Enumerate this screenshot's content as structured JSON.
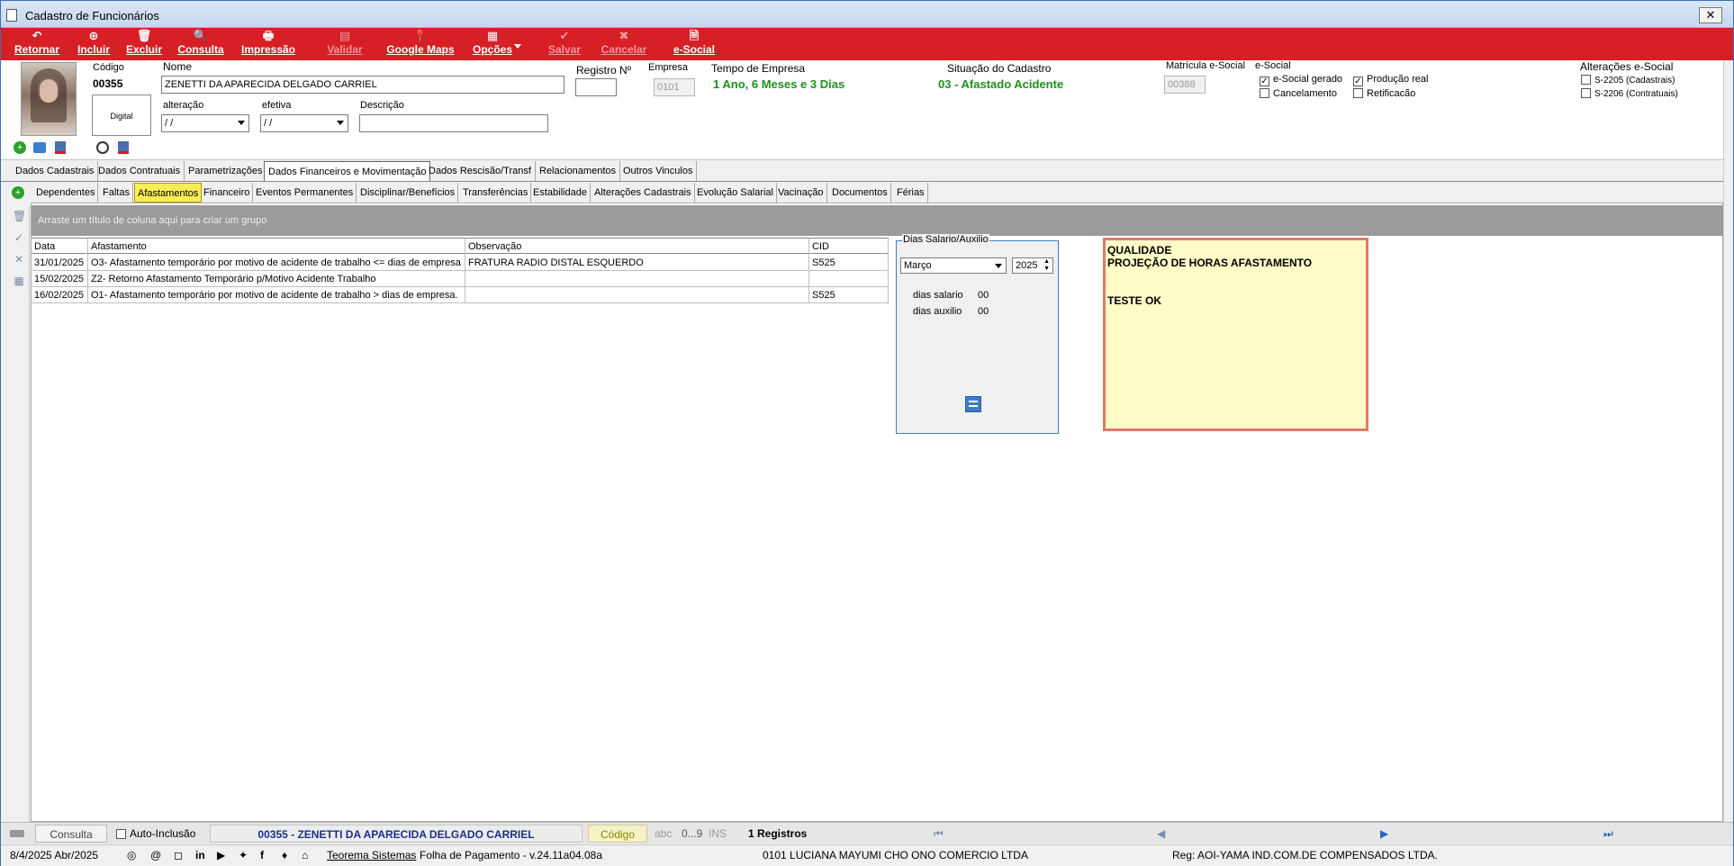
{
  "window": {
    "title": "Cadastro de Funcionários",
    "close_glyph": "✕"
  },
  "toolbar": [
    {
      "id": "retornar",
      "label": "Retornar",
      "icon": "↶"
    },
    {
      "id": "incluir",
      "label": "Incluir",
      "icon": "⊕"
    },
    {
      "id": "excluir",
      "label": "Excluir",
      "icon": "🗑"
    },
    {
      "id": "consulta",
      "label": "Consulta",
      "icon": "🔍"
    },
    {
      "id": "impressao",
      "label": "Impressão",
      "icon": "🖶"
    },
    {
      "id": "validar",
      "label": "Validar",
      "icon": "▤"
    },
    {
      "id": "googlemaps",
      "label": "Google Maps",
      "icon": "📍"
    },
    {
      "id": "opcoes",
      "label": "Opções",
      "icon": "▦"
    },
    {
      "id": "salvar",
      "label": "Salvar",
      "icon": "✔"
    },
    {
      "id": "cancelar",
      "label": "Cancelar",
      "icon": "✖"
    },
    {
      "id": "esocial",
      "label": "e-Social",
      "icon": "🗎"
    }
  ],
  "header": {
    "codigo_label": "Código",
    "codigo_value": "00355",
    "digital_label": "Digital",
    "nome_label": "Nome",
    "nome_value": "ZENETTI DA APARECIDA DELGADO CARRIEL",
    "registro_label": "Registro Nº",
    "registro_value": "",
    "empresa_label": "Empresa",
    "empresa_value": "0101",
    "tempo_label": "Tempo de Empresa",
    "tempo_value": "1 Ano, 6 Meses  e 3 Dias",
    "situacao_label": "Situação do Cadastro",
    "situacao_value": "03 - Afastado Acidente",
    "matricula_label": "Matrícula e-Social",
    "matricula_value": "00388",
    "esocial_label": "e-Social",
    "alteracao_label": "alteração",
    "alteracao_value": " / /",
    "efetiva_label": "efetiva",
    "efetiva_value": " / /",
    "descricao_label": "Descrição",
    "descricao_value": "",
    "checks": {
      "esocial_gerado": "e-Social gerado",
      "producao_real": "Produção real",
      "cancelamento": "Cancelamento",
      "retificacao": "Retificacão"
    },
    "alteracoes_label": "Alterações e-Social",
    "s2205": "S-2205 (Cadastrais)",
    "s2206": "S-2206 (Contratuais)"
  },
  "tabs": [
    "Dados Cadastrais",
    "Dados Contratuais",
    "Parametrizações",
    "Dados Financeiros e Movimentação",
    "Dados Rescisão/Transf",
    "Relacionamentos",
    "Outros Vinculos"
  ],
  "subtabs": [
    "Dependentes",
    "Faltas",
    "Afastamentos",
    "Financeiro",
    "Eventos Permanentes",
    "Disciplinar/Benefícios",
    "Transferências",
    "Estabilidade",
    "Alterações Cadastrais",
    "Evolução Salarial",
    "Vacinação",
    "Documentos",
    "Férias"
  ],
  "grid": {
    "group_hint": "Arraste um título de coluna aqui para criar um grupo",
    "columns": [
      "Data",
      "Afastamento",
      "Observação",
      "CID"
    ],
    "rows": [
      [
        "31/01/2025",
        "O3- Afastamento temporário por motivo de acidente de trabalho <= dias de empresa",
        "FRATURA RADIO DISTAL ESQUERDO",
        "S525"
      ],
      [
        "15/02/2025",
        "Z2- Retorno Afastamento Temporário p/Motivo Acidente Trabalho",
        "",
        ""
      ],
      [
        "16/02/2025",
        "O1- Afastamento temporário por motivo de acidente de trabalho > dias de empresa.",
        "",
        "S525"
      ]
    ]
  },
  "dias": {
    "legend": "Dias Salario/Auxilio",
    "mes": "Março",
    "ano": "2025",
    "dias_salario_label": "dias salario",
    "dias_salario_value": "00",
    "dias_auxilio_label": "dias auxilio",
    "dias_auxilio_value": "00"
  },
  "obs": {
    "line1": "QUALIDADE",
    "line2": "PROJEÇÃO DE HORAS AFASTAMENTO",
    "line3": "TESTE OK"
  },
  "statusbar": {
    "consulta": "Consulta",
    "auto_inclusao": "Auto-Inclusão",
    "record": "00355 - ZENETTI DA APARECIDA DELGADO CARRIEL",
    "codigo": "Código",
    "abc": "abc",
    "num": "0...9",
    "ins": "INS",
    "registros": "1 Registros"
  },
  "footer": {
    "date": "8/4/2025 Abr/2025",
    "teorema": "Teorema Sistemas",
    "versao": "Folha de Pagamento - v.24.11a04.08a",
    "empresa": "0101 LUCIANA MAYUMI CHO ONO COMERCIO LTDA",
    "reg": "Reg: AOI-YAMA IND.COM.DE COMPENSADOS LTDA."
  }
}
